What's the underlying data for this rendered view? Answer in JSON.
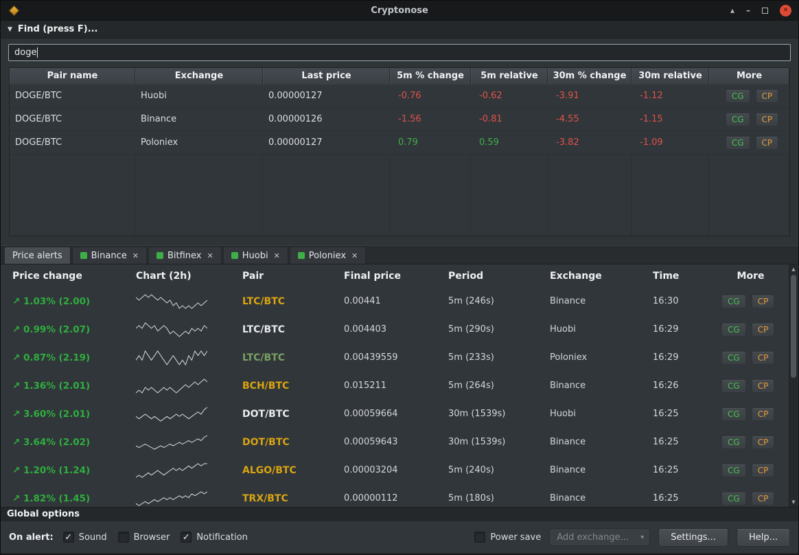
{
  "window": {
    "title": "Cryptonose",
    "controls": {
      "keep_above": "▴",
      "minimize": "–",
      "close": "✕"
    }
  },
  "find_panel": {
    "collapse_icon": "▼",
    "header": "Find (press F)...",
    "search_value": "doge"
  },
  "buttons": {
    "cg": "CG",
    "cp": "CP"
  },
  "pairs_table": {
    "columns": [
      "Pair name",
      "Exchange",
      "Last price",
      "5m % change",
      "5m relative",
      "30m % change",
      "30m relative",
      "More"
    ],
    "rows": [
      {
        "pair": "DOGE/BTC",
        "exchange": "Huobi",
        "last_price": "0.00000127",
        "changes": [
          "-0.76",
          "-0.62",
          "-3.91",
          "-1.12"
        ]
      },
      {
        "pair": "DOGE/BTC",
        "exchange": "Binance",
        "last_price": "0.00000126",
        "changes": [
          "-1.56",
          "-0.81",
          "-4.55",
          "-1.15"
        ]
      },
      {
        "pair": "DOGE/BTC",
        "exchange": "Poloniex",
        "last_price": "0.00000127",
        "changes": [
          "0.79",
          "0.59",
          "-3.82",
          "-1.09"
        ]
      }
    ]
  },
  "tabs": [
    {
      "label": "Price alerts",
      "active": true,
      "closable": false
    },
    {
      "label": "Binance",
      "active": false,
      "closable": true
    },
    {
      "label": "Bitfinex",
      "active": false,
      "closable": true
    },
    {
      "label": "Huobi",
      "active": false,
      "closable": true
    },
    {
      "label": "Poloniex",
      "active": false,
      "closable": true
    }
  ],
  "tab_close_icon": "✕",
  "alerts_table": {
    "columns": [
      "Price change",
      "Chart (2h)",
      "Pair",
      "Final price",
      "Period",
      "Exchange",
      "Time",
      "More"
    ],
    "up_arrow": "↗",
    "rows": [
      {
        "change": "1.03% (2.00)",
        "pair": "LTC/BTC",
        "pair_color": "#d9a411",
        "final_price": "0.00441",
        "period": "5m (246s)",
        "exchange": "Binance",
        "time": "16:30",
        "spark": [
          6,
          5,
          6,
          7,
          6,
          7,
          6,
          5,
          6,
          5,
          4,
          5,
          3,
          4,
          2,
          3,
          2,
          3,
          2,
          3,
          4,
          3,
          4,
          5
        ]
      },
      {
        "change": "0.99% (2.07)",
        "pair": "LTC/BTC",
        "pair_color": "#e8eaec",
        "final_price": "0.004403",
        "period": "5m (290s)",
        "exchange": "Huobi",
        "time": "16:29",
        "spark": [
          5,
          6,
          5,
          7,
          6,
          5,
          6,
          4,
          5,
          6,
          5,
          3,
          4,
          3,
          2,
          3,
          4,
          3,
          5,
          4,
          5,
          4,
          6,
          5
        ]
      },
      {
        "change": "0.87% (2.19)",
        "pair": "LTC/BTC",
        "pair_color": "#79a163",
        "final_price": "0.00439559",
        "period": "5m (233s)",
        "exchange": "Poloniex",
        "time": "16:29",
        "spark": [
          4,
          5,
          4,
          6,
          5,
          4,
          5,
          6,
          5,
          4,
          3,
          4,
          5,
          4,
          3,
          4,
          3,
          5,
          4,
          6,
          5,
          6,
          5,
          6
        ]
      },
      {
        "change": "1.36% (2.01)",
        "pair": "BCH/BTC",
        "pair_color": "#d9a411",
        "final_price": "0.015211",
        "period": "5m (264s)",
        "exchange": "Binance",
        "time": "16:26",
        "spark": [
          3,
          4,
          3,
          5,
          4,
          5,
          4,
          3,
          4,
          5,
          4,
          5,
          4,
          3,
          4,
          5,
          6,
          5,
          6,
          7,
          6,
          7,
          8,
          7
        ]
      },
      {
        "change": "3.60% (2.01)",
        "pair": "DOT/BTC",
        "pair_color": "#e8eaec",
        "final_price": "0.00059664",
        "period": "30m (1539s)",
        "exchange": "Huobi",
        "time": "16:25",
        "spark": [
          5,
          4,
          5,
          6,
          5,
          4,
          5,
          4,
          3,
          4,
          5,
          4,
          5,
          6,
          5,
          6,
          5,
          4,
          5,
          6,
          7,
          6,
          8,
          9
        ]
      },
      {
        "change": "3.64% (2.02)",
        "pair": "DOT/BTC",
        "pair_color": "#d9a411",
        "final_price": "0.00059643",
        "period": "30m (1539s)",
        "exchange": "Binance",
        "time": "16:25",
        "spark": [
          4,
          3,
          4,
          5,
          4,
          3,
          2,
          3,
          4,
          3,
          4,
          5,
          4,
          5,
          6,
          5,
          6,
          7,
          6,
          7,
          8,
          7,
          9,
          10
        ]
      },
      {
        "change": "1.20% (1.24)",
        "pair": "ALGO/BTC",
        "pair_color": "#d9a411",
        "final_price": "0.00003204",
        "period": "5m (240s)",
        "exchange": "Binance",
        "time": "16:25",
        "spark": [
          2,
          3,
          2,
          3,
          4,
          3,
          4,
          5,
          4,
          3,
          4,
          5,
          6,
          5,
          6,
          5,
          6,
          7,
          6,
          7,
          8,
          7,
          8,
          8
        ]
      },
      {
        "change": "1.82% (1.45)",
        "pair": "TRX/BTC",
        "pair_color": "#d9a411",
        "final_price": "0.00000112",
        "period": "5m (180s)",
        "exchange": "Binance",
        "time": "16:25",
        "spark": [
          3,
          2,
          3,
          4,
          3,
          4,
          5,
          4,
          5,
          6,
          5,
          6,
          5,
          6,
          7,
          6,
          7,
          6,
          8,
          7,
          8,
          9,
          8,
          9
        ]
      }
    ]
  },
  "scrollbar": {
    "up_icon": "▲",
    "down_icon": "▼"
  },
  "global_options": {
    "header": "Global options",
    "on_alert_label": "On alert:",
    "check_icon": "✓",
    "checkboxes": [
      {
        "label": "Sound",
        "checked": true
      },
      {
        "label": "Browser",
        "checked": false
      },
      {
        "label": "Notification",
        "checked": true
      }
    ],
    "power_save": {
      "label": "Power save",
      "checked": false
    },
    "add_exchange_placeholder": "Add exchange...",
    "dropdown_icon": "▾",
    "settings_label": "Settings...",
    "help_label": "Help..."
  },
  "colors": {
    "positive": "#3fae49",
    "negative": "#e0524a",
    "alert_green": "#2fae3e",
    "cg_green": "#45c04f",
    "cp_orange": "#e39b3c"
  }
}
